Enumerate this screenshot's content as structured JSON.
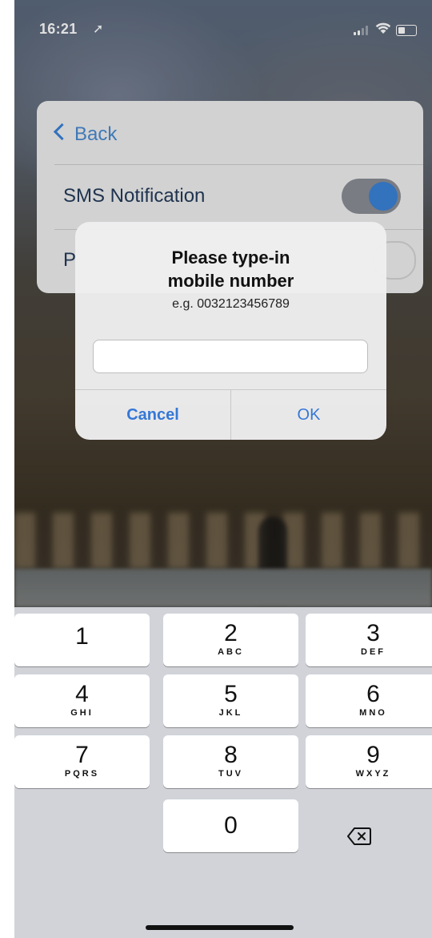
{
  "status_bar": {
    "time": "16:21"
  },
  "settings": {
    "back_label": "Back",
    "row1_label": "SMS Notification",
    "row2_label": "P"
  },
  "alert": {
    "title_line1": "Please type-in",
    "title_line2": "mobile number",
    "message": "e.g. 0032123456789",
    "input_value": "",
    "cancel_label": "Cancel",
    "ok_label": "OK"
  },
  "keypad": {
    "keys": [
      {
        "num": "1",
        "letters": ""
      },
      {
        "num": "2",
        "letters": "ABC"
      },
      {
        "num": "3",
        "letters": "DEF"
      },
      {
        "num": "4",
        "letters": "GHI"
      },
      {
        "num": "5",
        "letters": "JKL"
      },
      {
        "num": "6",
        "letters": "MNO"
      },
      {
        "num": "7",
        "letters": "PQRS"
      },
      {
        "num": "8",
        "letters": "TUV"
      },
      {
        "num": "9",
        "letters": "WXYZ"
      },
      {
        "num": "0",
        "letters": ""
      }
    ],
    "delete_icon": "delete-backspace-icon"
  },
  "colors": {
    "accent": "#3478d6",
    "toggle_on": "#3b82d6",
    "keypad_bg": "#d1d3d9"
  }
}
